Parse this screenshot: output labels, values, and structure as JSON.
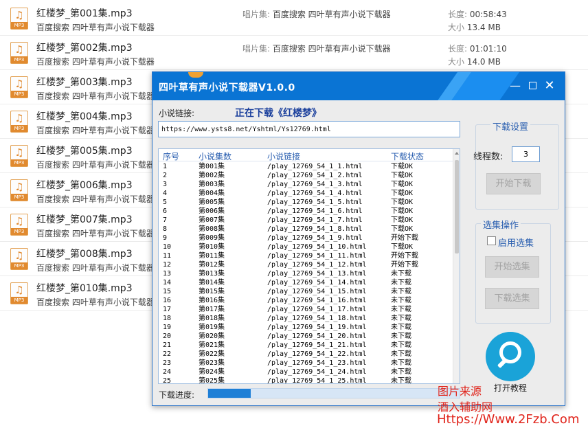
{
  "files": [
    {
      "name": "红楼梦_第001集.mp3",
      "source": "百度搜索 四叶草有声小说下载器",
      "album_label": "唱片集:",
      "album": "百度搜索 四叶草有声小说下载器",
      "duration_label": "长度:",
      "duration": "00:58:43",
      "size_label": "大小",
      "size": "13.4 MB"
    },
    {
      "name": "红楼梦_第002集.mp3",
      "source": "百度搜索 四叶草有声小说下载器",
      "album_label": "唱片集:",
      "album": "百度搜索 四叶草有声小说下载器",
      "duration_label": "长度:",
      "duration": "01:01:10",
      "size_label": "大小",
      "size": "14.0 MB"
    },
    {
      "name": "红楼梦_第003集.mp3",
      "source": "百度搜索 四叶草有声小说下载器"
    },
    {
      "name": "红楼梦_第004集.mp3",
      "source": "百度搜索 四叶草有声小说下载器"
    },
    {
      "name": "红楼梦_第005集.mp3",
      "source": "百度搜索 四叶草有声小说下载器"
    },
    {
      "name": "红楼梦_第006集.mp3",
      "source": "百度搜索 四叶草有声小说下载器"
    },
    {
      "name": "红楼梦_第007集.mp3",
      "source": "百度搜索 四叶草有声小说下载器"
    },
    {
      "name": "红楼梦_第008集.mp3",
      "source": "百度搜索 四叶草有声小说下载器"
    },
    {
      "name": "红楼梦_第010集.mp3",
      "source": "百度搜索 四叶草有声小说下载器"
    }
  ],
  "mp3_icon": {
    "glyph": "♫",
    "tag": "MP3",
    "color": "#e18a2f"
  },
  "window": {
    "title": "四叶草有声小说下载器V1.0.0",
    "title_bar_color": "#0a74d4",
    "min_glyph": "—",
    "close_glyph": "✕"
  },
  "link_label": "小说链接:",
  "status": "正在下载《红楼梦》",
  "url": "https://www.ysts8.net/Yshtml/Ys12769.html",
  "table": {
    "headers": [
      "序号",
      "小说集数",
      "小说链接",
      "下载状态"
    ],
    "rows": [
      [
        "1",
        "第001集",
        "/play_12769_54_1_1.html",
        "下载OK"
      ],
      [
        "2",
        "第002集",
        "/play_12769_54_1_2.html",
        "下载OK"
      ],
      [
        "3",
        "第003集",
        "/play_12769_54_1_3.html",
        "下载OK"
      ],
      [
        "4",
        "第004集",
        "/play_12769_54_1_4.html",
        "下载OK"
      ],
      [
        "5",
        "第005集",
        "/play_12769_54_1_5.html",
        "下载OK"
      ],
      [
        "6",
        "第006集",
        "/play_12769_54_1_6.html",
        "下载OK"
      ],
      [
        "7",
        "第007集",
        "/play_12769_54_1_7.html",
        "下载OK"
      ],
      [
        "8",
        "第008集",
        "/play_12769_54_1_8.html",
        "下载OK"
      ],
      [
        "9",
        "第009集",
        "/play_12769_54_1_9.html",
        "开始下载"
      ],
      [
        "10",
        "第010集",
        "/play_12769_54_1_10.html",
        "下载OK"
      ],
      [
        "11",
        "第011集",
        "/play_12769_54_1_11.html",
        "开始下载"
      ],
      [
        "12",
        "第012集",
        "/play_12769_54_1_12.html",
        "开始下载"
      ],
      [
        "13",
        "第013集",
        "/play_12769_54_1_13.html",
        "未下载"
      ],
      [
        "14",
        "第014集",
        "/play_12769_54_1_14.html",
        "未下载"
      ],
      [
        "15",
        "第015集",
        "/play_12769_54_1_15.html",
        "未下载"
      ],
      [
        "16",
        "第016集",
        "/play_12769_54_1_16.html",
        "未下载"
      ],
      [
        "17",
        "第017集",
        "/play_12769_54_1_17.html",
        "未下载"
      ],
      [
        "18",
        "第018集",
        "/play_12769_54_1_18.html",
        "未下载"
      ],
      [
        "19",
        "第019集",
        "/play_12769_54_1_19.html",
        "未下载"
      ],
      [
        "20",
        "第020集",
        "/play_12769_54_1_20.html",
        "未下载"
      ],
      [
        "21",
        "第021集",
        "/play_12769_54_1_21.html",
        "未下载"
      ],
      [
        "22",
        "第022集",
        "/play_12769_54_1_22.html",
        "未下载"
      ],
      [
        "23",
        "第023集",
        "/play_12769_54_1_23.html",
        "未下载"
      ],
      [
        "24",
        "第024集",
        "/play_12769_54_1_24.html",
        "未下载"
      ],
      [
        "25",
        "第025集",
        "/play_12769_54_1_25.html",
        "未下载"
      ]
    ]
  },
  "progress": {
    "label": "下载进度:",
    "fraction": 0.17
  },
  "settings": {
    "title": "下载设置",
    "threads_label": "线程数:",
    "threads_value": "3",
    "start_button": "开始下载"
  },
  "selection": {
    "title": "选集操作",
    "enable_label": "启用选集",
    "enabled": false,
    "start_select_button": "开始选集",
    "download_select_button": "下载选集"
  },
  "help": {
    "label": "打开教程",
    "icon": "search-icon",
    "color": "#1aa3d8"
  },
  "watermark": {
    "line1": "图片来源",
    "line2": "酒入辅助网",
    "line3": "Https://Www.2Fzb.Com"
  }
}
